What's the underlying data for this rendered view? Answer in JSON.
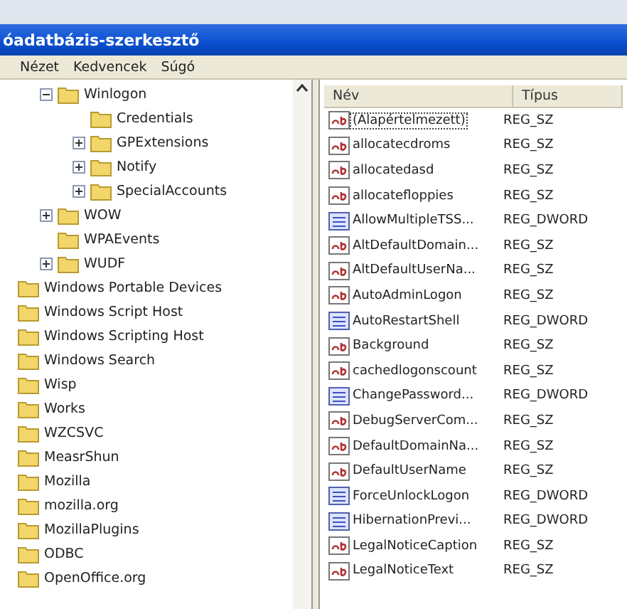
{
  "window": {
    "title": "óadatbázis-szerkesztő"
  },
  "menu": [
    "Nézet",
    "Kedvencek",
    "Súgó"
  ],
  "tree_sections": [
    {
      "items": [
        {
          "label": "Winlogon",
          "expanded": true,
          "children": [
            {
              "label": "Credentials"
            },
            {
              "label": "GPExtensions",
              "expanded": false
            },
            {
              "label": "Notify",
              "expanded": false
            },
            {
              "label": "SpecialAccounts",
              "expanded": false
            }
          ]
        },
        {
          "label": "WOW",
          "expanded": false
        },
        {
          "label": "WPAEvents"
        },
        {
          "label": "WUDF",
          "expanded": false
        }
      ]
    },
    {
      "items": [
        {
          "label": "Windows Portable Devices"
        },
        {
          "label": "Windows Script Host"
        },
        {
          "label": "Windows Scripting Host"
        },
        {
          "label": "Windows Search"
        },
        {
          "label": "Wisp"
        },
        {
          "label": "Works"
        },
        {
          "label": "WZCSVC"
        }
      ]
    },
    {
      "items": [
        {
          "label": "MeasrShun"
        },
        {
          "label": "Mozilla"
        },
        {
          "label": "mozilla.org"
        },
        {
          "label": "MozillaPlugins"
        },
        {
          "label": "ODBC"
        },
        {
          "label": "OpenOffice.org"
        }
      ]
    }
  ],
  "values": {
    "columns": [
      "Név",
      "Típus"
    ],
    "rows": [
      {
        "name": "(Alapértelmezett)",
        "type": "REG_SZ",
        "kind": "sz",
        "focused": true
      },
      {
        "name": "allocatecdroms",
        "type": "REG_SZ",
        "kind": "sz",
        "focused": false
      },
      {
        "name": "allocatedasd",
        "type": "REG_SZ",
        "kind": "sz",
        "focused": false
      },
      {
        "name": "allocatefloppies",
        "type": "REG_SZ",
        "kind": "sz",
        "focused": false
      },
      {
        "name": "AllowMultipleTSS...",
        "type": "REG_DWORD",
        "kind": "dword",
        "focused": false
      },
      {
        "name": "AltDefaultDomain...",
        "type": "REG_SZ",
        "kind": "sz",
        "focused": false
      },
      {
        "name": "AltDefaultUserNa...",
        "type": "REG_SZ",
        "kind": "sz",
        "focused": false
      },
      {
        "name": "AutoAdminLogon",
        "type": "REG_SZ",
        "kind": "sz",
        "focused": false
      },
      {
        "name": "AutoRestartShell",
        "type": "REG_DWORD",
        "kind": "dword",
        "focused": false
      },
      {
        "name": "Background",
        "type": "REG_SZ",
        "kind": "sz",
        "focused": false
      },
      {
        "name": "cachedlogonscount",
        "type": "REG_SZ",
        "kind": "sz",
        "focused": false
      },
      {
        "name": "ChangePassword...",
        "type": "REG_DWORD",
        "kind": "dword",
        "focused": false
      },
      {
        "name": "DebugServerCom...",
        "type": "REG_SZ",
        "kind": "sz",
        "focused": false
      },
      {
        "name": "DefaultDomainNa...",
        "type": "REG_SZ",
        "kind": "sz",
        "focused": false
      },
      {
        "name": "DefaultUserName",
        "type": "REG_SZ",
        "kind": "sz",
        "focused": false
      },
      {
        "name": "ForceUnlockLogon",
        "type": "REG_DWORD",
        "kind": "dword",
        "focused": false
      },
      {
        "name": "HibernationPrevi...",
        "type": "REG_DWORD",
        "kind": "dword",
        "focused": false
      },
      {
        "name": "LegalNoticeCaption",
        "type": "REG_SZ",
        "kind": "sz",
        "focused": false
      },
      {
        "name": "LegalNoticeText",
        "type": "REG_SZ",
        "kind": "sz",
        "focused": false
      }
    ]
  }
}
